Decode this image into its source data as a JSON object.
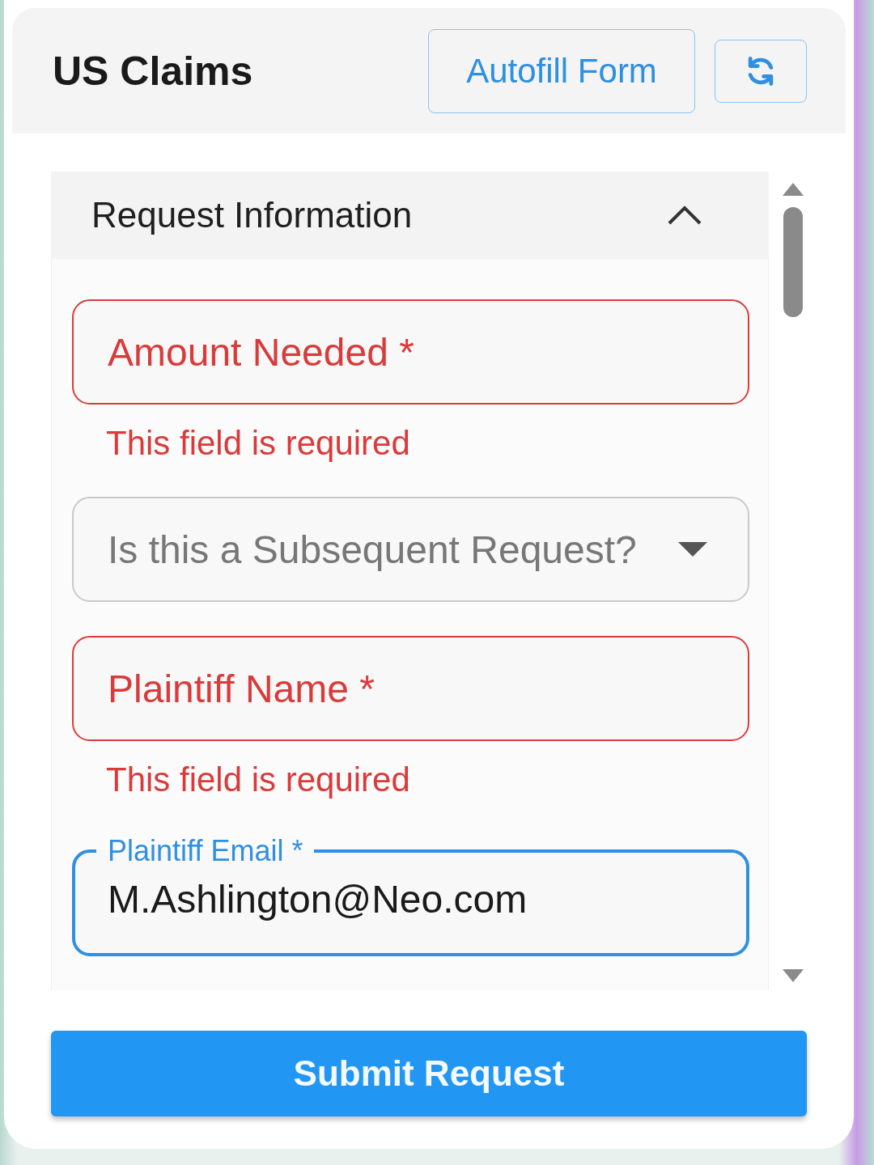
{
  "header": {
    "title": "US Claims",
    "autofill_button": "Autofill Form"
  },
  "section": {
    "title": "Request Information",
    "expanded": true,
    "fields": [
      {
        "kind": "text",
        "label": "Amount Needed *",
        "error": "This field is required",
        "focused": false
      },
      {
        "kind": "select",
        "label": "Is this a Subsequent Request?",
        "focused": false
      },
      {
        "kind": "text",
        "label": "Plaintiff Name *",
        "error": "This field is required",
        "focused": false
      },
      {
        "kind": "text",
        "label": "Plaintiff Email *",
        "value": "M.Ashlington@Neo.com",
        "focused": true
      }
    ]
  },
  "submit_button": "Submit Request"
}
